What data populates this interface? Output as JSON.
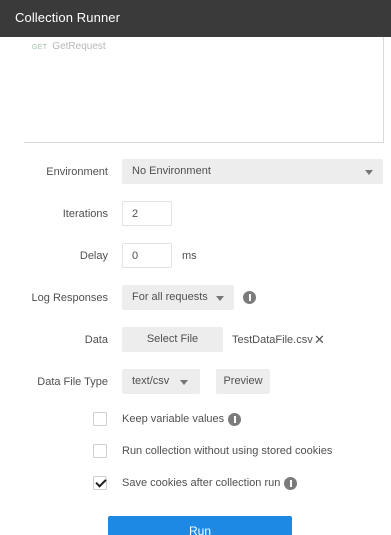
{
  "window": {
    "title": "Collection Runner"
  },
  "requests": [
    {
      "method": "GET",
      "name": "GetRequest"
    }
  ],
  "environment": {
    "label": "Environment",
    "value": "No Environment"
  },
  "iterations": {
    "label": "Iterations",
    "value": "2"
  },
  "delay": {
    "label": "Delay",
    "value": "0",
    "unit": "ms"
  },
  "log_responses": {
    "label": "Log Responses",
    "value": "For all requests"
  },
  "data": {
    "label": "Data",
    "select_file_label": "Select File",
    "file_name": "TestDataFile.csv"
  },
  "data_file_type": {
    "label": "Data File Type",
    "value": "text/csv",
    "preview_label": "Preview"
  },
  "options": [
    {
      "label": "Keep variable values",
      "checked": false,
      "info": true
    },
    {
      "label": "Run collection without using stored cookies",
      "checked": false,
      "info": false
    },
    {
      "label": "Save cookies after collection run",
      "checked": true,
      "info": true
    }
  ],
  "run_button": {
    "label": "Run"
  }
}
